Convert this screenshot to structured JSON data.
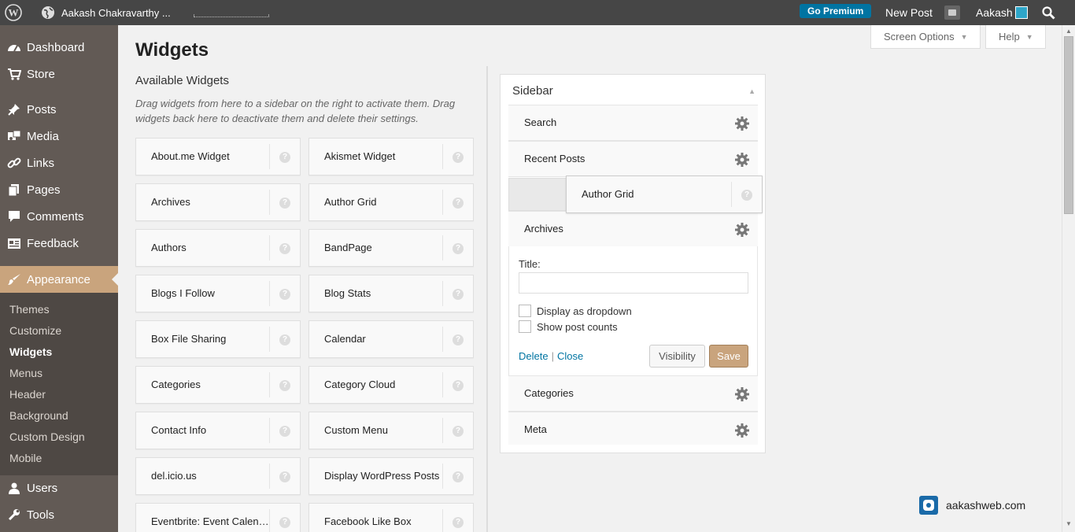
{
  "admin_bar": {
    "site_name": "Aakash Chakravarthy ...",
    "go_premium": "Go Premium",
    "new_post": "New Post",
    "user_name": "Aakash"
  },
  "menu": {
    "items": [
      {
        "label": "Dashboard",
        "icon": "dashboard-icon"
      },
      {
        "label": "Store",
        "icon": "cart-icon"
      },
      {
        "label": "Posts",
        "icon": "pin-icon"
      },
      {
        "label": "Media",
        "icon": "media-icon"
      },
      {
        "label": "Links",
        "icon": "link-icon"
      },
      {
        "label": "Pages",
        "icon": "pages-icon"
      },
      {
        "label": "Comments",
        "icon": "comment-icon"
      },
      {
        "label": "Feedback",
        "icon": "feedback-icon"
      },
      {
        "label": "Appearance",
        "icon": "brush-icon"
      },
      {
        "label": "Users",
        "icon": "user-icon"
      },
      {
        "label": "Tools",
        "icon": "wrench-icon"
      }
    ],
    "appearance_submenu": [
      "Themes",
      "Customize",
      "Widgets",
      "Menus",
      "Header",
      "Background",
      "Custom Design",
      "Mobile"
    ],
    "current_submenu": "Widgets"
  },
  "page": {
    "title": "Widgets",
    "screen_options": "Screen Options",
    "help": "Help"
  },
  "available": {
    "title": "Available Widgets",
    "description": "Drag widgets from here to a sidebar on the right to activate them. Drag widgets back here to deactivate them and delete their settings.",
    "widgets_left": [
      "About.me Widget",
      "Archives",
      "Authors",
      "Blogs I Follow",
      "Box File Sharing",
      "Categories",
      "Contact Info",
      "del.icio.us",
      "Eventbrite: Event Calendar/Listing"
    ],
    "widgets_right": [
      "Akismet Widget",
      "Author Grid",
      "BandPage",
      "Blog Stats",
      "Calendar",
      "Category Cloud",
      "Custom Menu",
      "Display WordPress Posts",
      "Facebook Like Box"
    ]
  },
  "sidebar": {
    "title": "Sidebar",
    "widgets": [
      "Search",
      "Recent Posts",
      "Archives",
      "Categories",
      "Meta"
    ],
    "dragging_widget": "Author Grid",
    "archives_form": {
      "title_label": "Title:",
      "title_value": "",
      "dropdown_label": "Display as dropdown",
      "counts_label": "Show post counts",
      "delete": "Delete",
      "close": "Close",
      "separator": "|",
      "visibility": "Visibility",
      "save": "Save"
    }
  },
  "watermark": "aakashweb.com",
  "colors": {
    "admin_bar": "#464646",
    "menu_bg": "#625a55",
    "accent": "#c9a47d",
    "link": "#0074a2"
  }
}
